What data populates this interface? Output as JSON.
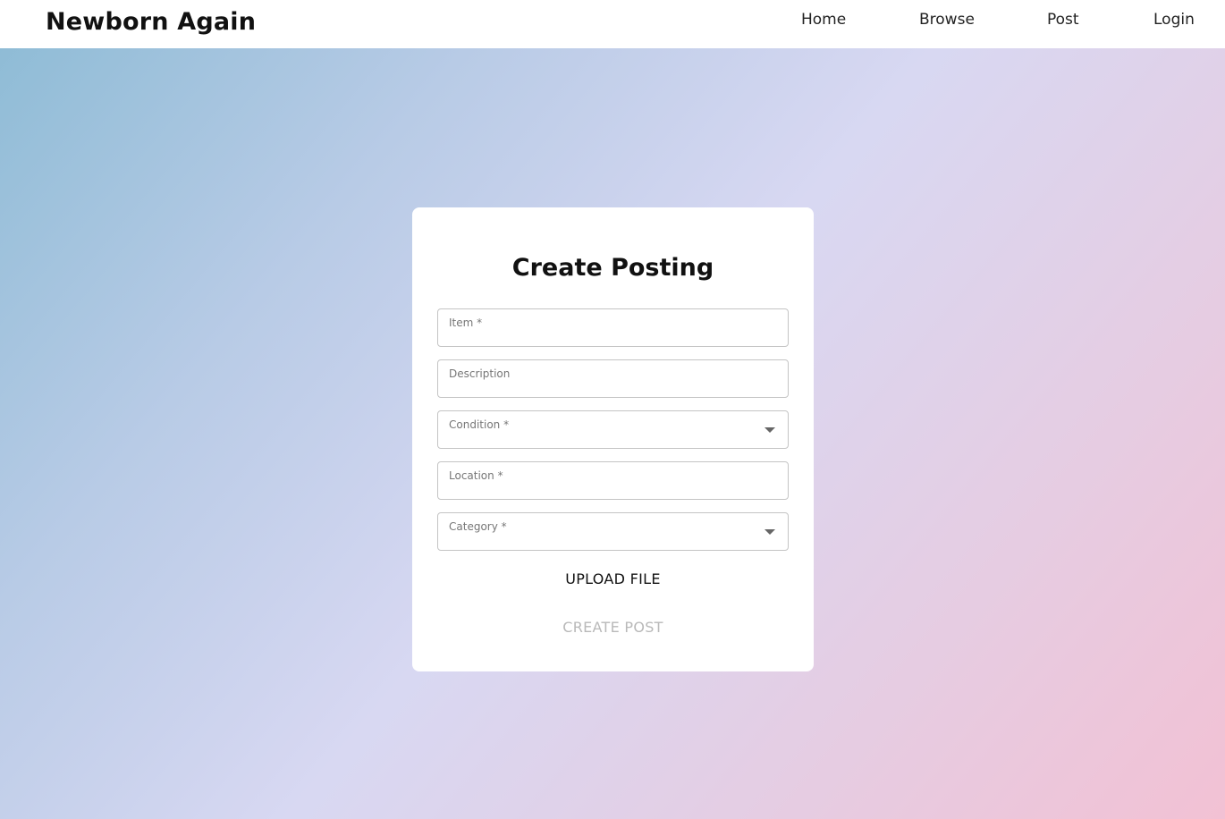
{
  "nav": {
    "brand": "Newborn Again",
    "links": [
      "Home",
      "Browse",
      "Post",
      "Login"
    ]
  },
  "form": {
    "title": "Create Posting",
    "fields": [
      {
        "label": "Item *",
        "type": "text",
        "value": ""
      },
      {
        "label": "Description",
        "type": "text",
        "value": ""
      },
      {
        "label": "Condition *",
        "type": "select",
        "value": ""
      },
      {
        "label": "Location *",
        "type": "text",
        "value": ""
      },
      {
        "label": "Category *",
        "type": "select",
        "value": ""
      }
    ],
    "upload_label": "UPLOAD FILE",
    "submit_label": "CREATE POST",
    "submit_disabled": true
  },
  "colors": {
    "gradient": [
      "#8fbcd6",
      "#d8d8f2",
      "#f2c1d4"
    ],
    "card": "#ffffff",
    "disabled_text": "#b9b9b9"
  },
  "icons": {
    "select_caret": "chevron-down-icon"
  }
}
